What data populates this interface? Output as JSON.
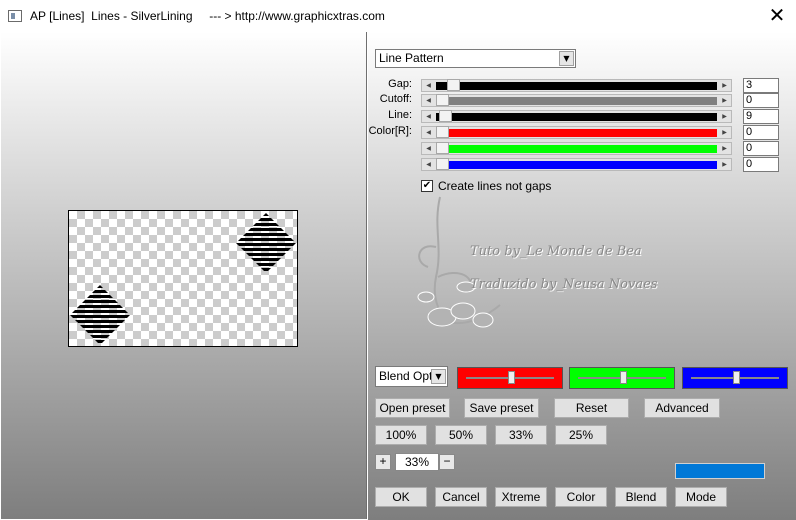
{
  "window": {
    "title": "AP [Lines]  Lines - SilverLining     --- > http://www.graphicxtras.com",
    "close_glyph": "✕"
  },
  "pattern_select": {
    "value": "Line Pattern"
  },
  "params": [
    {
      "label": "Gap:",
      "value": "3",
      "level": 0.04,
      "track_color": "#000000"
    },
    {
      "label": "Cutoff:",
      "value": "0",
      "level": 0.0,
      "track_color": "#808080"
    },
    {
      "label": "Line:",
      "value": "9",
      "level": 0.01,
      "track_color": "#000000"
    },
    {
      "label": "Color[R]:",
      "value": "0",
      "level": 0.0,
      "track_color": "#ff0000"
    },
    {
      "label": "",
      "value": "0",
      "level": 0.0,
      "track_color": "#00ff00"
    },
    {
      "label": "",
      "value": "0",
      "level": 0.0,
      "track_color": "#0000ff"
    }
  ],
  "checkbox": {
    "label": "Create lines not gaps",
    "checked": true,
    "mark": "✔"
  },
  "watermark": {
    "line1": "Tuto by_Le Monde de Bea",
    "line2": "Traduzido by_Neusa Novaes"
  },
  "blend_select": {
    "value": "Blend Optio"
  },
  "color_boxes": [
    {
      "color": "#ff0000",
      "level": 0.5
    },
    {
      "color": "#00ff00",
      "level": 0.5
    },
    {
      "color": "#0000ff",
      "level": 0.5
    }
  ],
  "preset_buttons": {
    "open": "Open preset",
    "save": "Save preset",
    "reset": "Reset",
    "advanced": "Advanced"
  },
  "zoom_buttons": [
    "100%",
    "50%",
    "33%",
    "25%"
  ],
  "zoom": {
    "plus": "+",
    "value": "33%",
    "minus": "−"
  },
  "swatch_color": "#0078d7",
  "bottom_buttons": {
    "ok": "OK",
    "cancel": "Cancel",
    "xtreme": "Xtreme",
    "color": "Color",
    "blend": "Blend",
    "mode": "Mode"
  }
}
